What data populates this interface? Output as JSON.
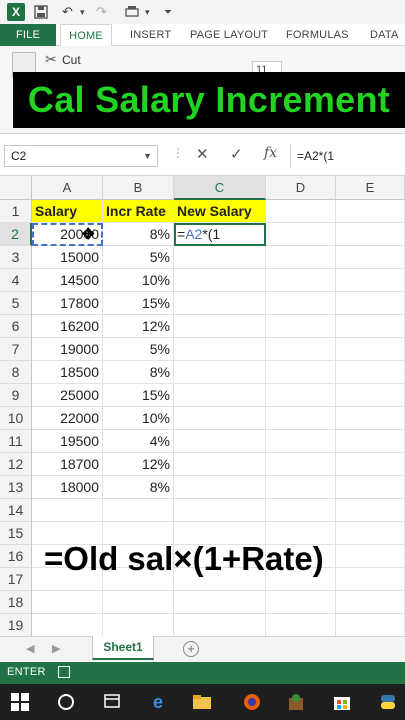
{
  "quick_access": {
    "excel_logo": "X",
    "icons": [
      "save-icon",
      "undo-icon",
      "redo-icon",
      "print-preview-icon",
      "customize-icon"
    ]
  },
  "ribbon": {
    "tabs": [
      "FILE",
      "HOME",
      "INSERT",
      "PAGE LAYOUT",
      "FORMULAS",
      "DATA"
    ],
    "cut_label": "Cut",
    "font_size": "11"
  },
  "banner": {
    "text": "Cal Salary Increment",
    "color": "#22d322"
  },
  "formula_bar": {
    "name_box": "C2",
    "formula": "=A2*(1"
  },
  "grid": {
    "columns": [
      "A",
      "B",
      "C",
      "D",
      "E"
    ],
    "rows": [
      "1",
      "2",
      "3",
      "4",
      "5",
      "6",
      "7",
      "8",
      "9",
      "10",
      "11",
      "12",
      "13",
      "14",
      "15",
      "16",
      "17",
      "18",
      "19"
    ],
    "headers": {
      "A": "Salary",
      "B": "Incr Rate",
      "C": "New Salary"
    },
    "data": [
      {
        "salary": "20000",
        "rate": "8%"
      },
      {
        "salary": "15000",
        "rate": "5%"
      },
      {
        "salary": "14500",
        "rate": "10%"
      },
      {
        "salary": "17800",
        "rate": "15%"
      },
      {
        "salary": "16200",
        "rate": "12%"
      },
      {
        "salary": "19000",
        "rate": "5%"
      },
      {
        "salary": "18500",
        "rate": "8%"
      },
      {
        "salary": "25000",
        "rate": "15%"
      },
      {
        "salary": "22000",
        "rate": "10%"
      },
      {
        "salary": "19500",
        "rate": "4%"
      },
      {
        "salary": "18700",
        "rate": "12%"
      },
      {
        "salary": "18000",
        "rate": "8%"
      }
    ],
    "editing_cell": {
      "prefix": "=",
      "ref": "A2",
      "rest": "*(1"
    }
  },
  "caption": "=Old sal×(1+Rate)",
  "sheets": {
    "active": "Sheet1"
  },
  "status_bar": {
    "mode": "ENTER"
  },
  "colors": {
    "accent": "#217346",
    "header_fill": "#ffff00",
    "ref_blue": "#4472c4"
  }
}
